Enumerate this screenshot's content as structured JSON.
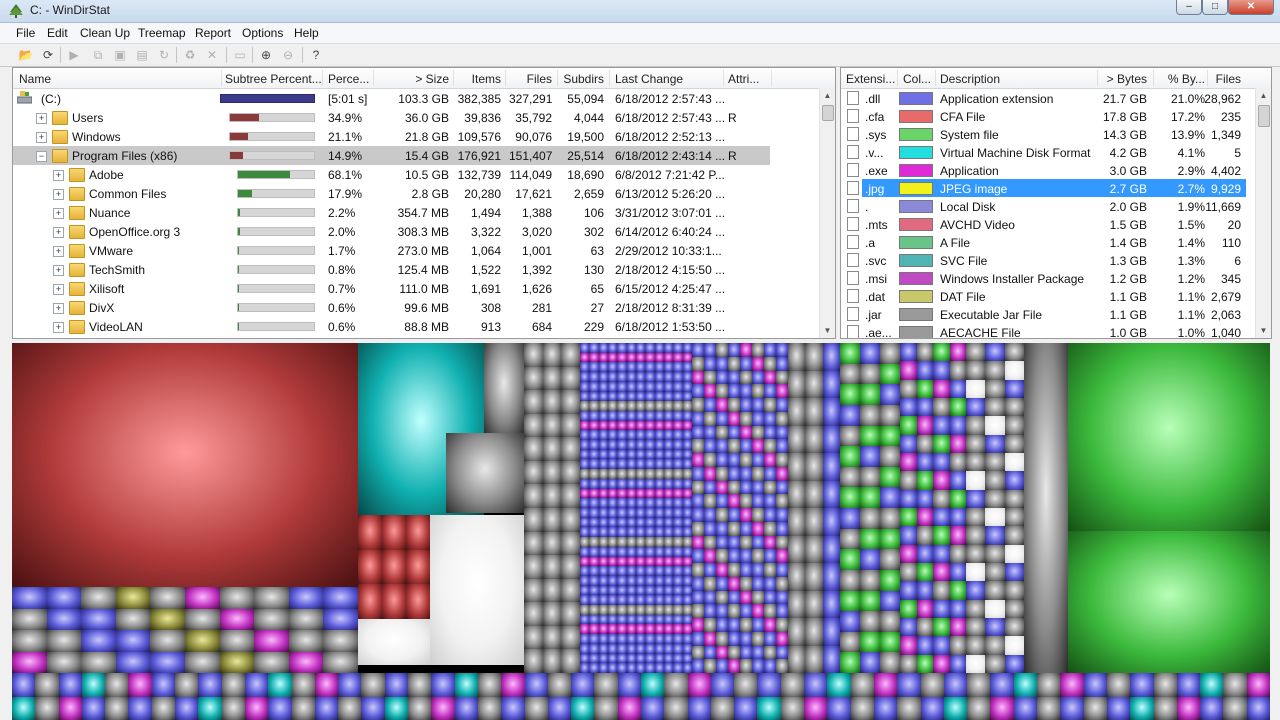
{
  "window": {
    "title": "C: - WinDirStat"
  },
  "window_controls": {
    "minimize": "–",
    "maximize": "□",
    "close": "✕"
  },
  "menu": [
    {
      "label": "File"
    },
    {
      "label": "Edit"
    },
    {
      "label": "Clean Up"
    },
    {
      "label": "Treemap"
    },
    {
      "label": "Report"
    },
    {
      "label": "Options"
    },
    {
      "label": "Help"
    }
  ],
  "toolbar": [
    {
      "icon": "open-icon",
      "glyph": "📂",
      "enabled": true
    },
    {
      "icon": "refresh-icon",
      "glyph": "⟳",
      "enabled": true
    },
    {
      "icon": "play-icon",
      "glyph": "▶",
      "enabled": false
    },
    {
      "icon": "copy-icon",
      "glyph": "⧉",
      "enabled": false
    },
    {
      "icon": "explorer-icon",
      "glyph": "▣",
      "enabled": false
    },
    {
      "icon": "command-prompt-icon",
      "glyph": "▤",
      "enabled": false
    },
    {
      "icon": "refresh-selected-icon",
      "glyph": "↻",
      "enabled": false
    },
    {
      "icon": "recycle-icon",
      "glyph": "♻",
      "enabled": false
    },
    {
      "icon": "delete-icon",
      "glyph": "✕",
      "enabled": false
    },
    {
      "icon": "properties-icon",
      "glyph": "▭",
      "enabled": false
    },
    {
      "icon": "zoom-in-icon",
      "glyph": "⊕",
      "enabled": true
    },
    {
      "icon": "zoom-out-icon",
      "glyph": "⊖",
      "enabled": false
    },
    {
      "icon": "help-icon",
      "glyph": "?",
      "enabled": true
    }
  ],
  "dir_headers": {
    "name": "Name",
    "subtree": "Subtree Percent...",
    "percent": "Perce...",
    "size": "> Size",
    "items": "Items",
    "files": "Files",
    "subdirs": "Subdirs",
    "last_change": "Last Change",
    "attributes": "Attri..."
  },
  "dir_rows": [
    {
      "name": "(C:)",
      "level": 0,
      "type": "drive",
      "expander": "",
      "subtree_pct": 100,
      "bar_color": "#3b3b8c",
      "percent": "[5:01 s]",
      "size": "103.3 GB",
      "items": "382,385",
      "files": "327,291",
      "subdirs": "55,094",
      "last_change": "6/18/2012 2:57:43 ...",
      "attr": "",
      "selected": false
    },
    {
      "name": "Users",
      "level": 1,
      "type": "folder",
      "expander": "+",
      "subtree_pct": 34.9,
      "bar_color": "#8b3a3a",
      "percent": "34.9%",
      "size": "36.0 GB",
      "items": "39,836",
      "files": "35,792",
      "subdirs": "4,044",
      "last_change": "6/18/2012 2:57:43 ...",
      "attr": "R",
      "selected": false
    },
    {
      "name": "Windows",
      "level": 1,
      "type": "folder",
      "expander": "+",
      "subtree_pct": 21.1,
      "bar_color": "#8b3a3a",
      "percent": "21.1%",
      "size": "21.8 GB",
      "items": "109,576",
      "files": "90,076",
      "subdirs": "19,500",
      "last_change": "6/18/2012 2:52:13 ...",
      "attr": "",
      "selected": false
    },
    {
      "name": "Program Files (x86)",
      "level": 1,
      "type": "folder",
      "expander": "−",
      "subtree_pct": 14.9,
      "bar_color": "#8b3a3a",
      "percent": "14.9%",
      "size": "15.4 GB",
      "items": "176,921",
      "files": "151,407",
      "subdirs": "25,514",
      "last_change": "6/18/2012 2:43:14 ...",
      "attr": "R",
      "selected": true
    },
    {
      "name": "Adobe",
      "level": 2,
      "type": "folder",
      "expander": "+",
      "subtree_pct": 68.1,
      "bar_color": "#3d8a3d",
      "percent": "68.1%",
      "size": "10.5 GB",
      "items": "132,739",
      "files": "114,049",
      "subdirs": "18,690",
      "last_change": "6/8/2012 7:21:42 P...",
      "attr": "",
      "selected": false
    },
    {
      "name": "Common Files",
      "level": 2,
      "type": "folder",
      "expander": "+",
      "subtree_pct": 17.9,
      "bar_color": "#3d8a3d",
      "percent": "17.9%",
      "size": "2.8 GB",
      "items": "20,280",
      "files": "17,621",
      "subdirs": "2,659",
      "last_change": "6/13/2012 5:26:20 ...",
      "attr": "",
      "selected": false
    },
    {
      "name": "Nuance",
      "level": 2,
      "type": "folder",
      "expander": "+",
      "subtree_pct": 2.2,
      "bar_color": "#3d8a3d",
      "percent": "2.2%",
      "size": "354.7 MB",
      "items": "1,494",
      "files": "1,388",
      "subdirs": "106",
      "last_change": "3/31/2012 3:07:01 ...",
      "attr": "",
      "selected": false
    },
    {
      "name": "OpenOffice.org 3",
      "level": 2,
      "type": "folder",
      "expander": "+",
      "subtree_pct": 2.0,
      "bar_color": "#3d8a3d",
      "percent": "2.0%",
      "size": "308.3 MB",
      "items": "3,322",
      "files": "3,020",
      "subdirs": "302",
      "last_change": "6/14/2012 6:40:24 ...",
      "attr": "",
      "selected": false
    },
    {
      "name": "VMware",
      "level": 2,
      "type": "folder",
      "expander": "+",
      "subtree_pct": 1.7,
      "bar_color": "#3d8a3d",
      "percent": "1.7%",
      "size": "273.0 MB",
      "items": "1,064",
      "files": "1,001",
      "subdirs": "63",
      "last_change": "2/29/2012 10:33:1...",
      "attr": "",
      "selected": false
    },
    {
      "name": "TechSmith",
      "level": 2,
      "type": "folder",
      "expander": "+",
      "subtree_pct": 0.8,
      "bar_color": "#3d8a3d",
      "percent": "0.8%",
      "size": "125.4 MB",
      "items": "1,522",
      "files": "1,392",
      "subdirs": "130",
      "last_change": "2/18/2012 4:15:50 ...",
      "attr": "",
      "selected": false
    },
    {
      "name": "Xilisoft",
      "level": 2,
      "type": "folder",
      "expander": "+",
      "subtree_pct": 0.7,
      "bar_color": "#3d8a3d",
      "percent": "0.7%",
      "size": "111.0 MB",
      "items": "1,691",
      "files": "1,626",
      "subdirs": "65",
      "last_change": "6/15/2012 4:25:47 ...",
      "attr": "",
      "selected": false
    },
    {
      "name": "DivX",
      "level": 2,
      "type": "folder",
      "expander": "+",
      "subtree_pct": 0.6,
      "bar_color": "#3d8a3d",
      "percent": "0.6%",
      "size": "99.6 MB",
      "items": "308",
      "files": "281",
      "subdirs": "27",
      "last_change": "2/18/2012 8:31:39 ...",
      "attr": "",
      "selected": false
    },
    {
      "name": "VideoLAN",
      "level": 2,
      "type": "folder",
      "expander": "+",
      "subtree_pct": 0.6,
      "bar_color": "#3d8a3d",
      "percent": "0.6%",
      "size": "88.8 MB",
      "items": "913",
      "files": "684",
      "subdirs": "229",
      "last_change": "6/18/2012 1:53:50 ...",
      "attr": "",
      "selected": false
    }
  ],
  "ext_headers": {
    "ext": "Extensi...",
    "color": "Col...",
    "desc": "Description",
    "bytes": "> Bytes",
    "pct": "% By...",
    "files": "Files"
  },
  "ext_rows": [
    {
      "ext": ".dll",
      "color": "#6f6fe6",
      "desc": "Application extension",
      "bytes": "21.7 GB",
      "pct": "21.0%",
      "files": "28,962",
      "icon": "dll-file-icon",
      "selected": false
    },
    {
      "ext": ".cfa",
      "color": "#e86a6a",
      "desc": "CFA File",
      "bytes": "17.8 GB",
      "pct": "17.2%",
      "files": "235",
      "icon": "cfa-file-icon",
      "selected": false
    },
    {
      "ext": ".sys",
      "color": "#6ad46a",
      "desc": "System file",
      "bytes": "14.3 GB",
      "pct": "13.9%",
      "files": "1,349",
      "icon": "sys-file-icon",
      "selected": false
    },
    {
      "ext": ".v...",
      "color": "#22dede",
      "desc": "Virtual Machine Disk Format",
      "bytes": "4.2 GB",
      "pct": "4.1%",
      "files": "5",
      "icon": "vmdk-file-icon",
      "selected": false
    },
    {
      "ext": ".exe",
      "color": "#e02ad8",
      "desc": "Application",
      "bytes": "3.0 GB",
      "pct": "2.9%",
      "files": "4,402",
      "icon": "exe-file-icon",
      "selected": false
    },
    {
      "ext": ".jpg",
      "color": "#f2f21a",
      "desc": "JPEG image",
      "bytes": "2.7 GB",
      "pct": "2.7%",
      "files": "9,929",
      "icon": "jpg-file-icon",
      "selected": true
    },
    {
      "ext": ".",
      "color": "#8a8ad8",
      "desc": "Local Disk",
      "bytes": "2.0 GB",
      "pct": "1.9%",
      "files": "11,669",
      "icon": "local-disk-icon",
      "selected": false
    },
    {
      "ext": ".mts",
      "color": "#e06a80",
      "desc": "AVCHD Video",
      "bytes": "1.5 GB",
      "pct": "1.5%",
      "files": "20",
      "icon": "mts-file-icon",
      "selected": false
    },
    {
      "ext": ".a",
      "color": "#6ac48a",
      "desc": "A File",
      "bytes": "1.4 GB",
      "pct": "1.4%",
      "files": "110",
      "icon": "a-file-icon",
      "selected": false
    },
    {
      "ext": ".svc",
      "color": "#4fb4b4",
      "desc": "SVC File",
      "bytes": "1.3 GB",
      "pct": "1.3%",
      "files": "6",
      "icon": "svc-file-icon",
      "selected": false
    },
    {
      "ext": ".msi",
      "color": "#c04ac4",
      "desc": "Windows Installer Package",
      "bytes": "1.2 GB",
      "pct": "1.2%",
      "files": "345",
      "icon": "msi-file-icon",
      "selected": false
    },
    {
      "ext": ".dat",
      "color": "#c8c86a",
      "desc": "DAT File",
      "bytes": "1.1 GB",
      "pct": "1.1%",
      "files": "2,679",
      "icon": "dat-file-icon",
      "selected": false
    },
    {
      "ext": ".jar",
      "color": "#9a9a9a",
      "desc": "Executable Jar File",
      "bytes": "1.1 GB",
      "pct": "1.1%",
      "files": "2,063",
      "icon": "jar-file-icon",
      "selected": false
    },
    {
      "ext": ".ae...",
      "color": "#9a9a9a",
      "desc": "AECACHE File",
      "bytes": "1.0 GB",
      "pct": "1.0%",
      "files": "1,040",
      "icon": "aecache-file-icon",
      "selected": false
    }
  ]
}
